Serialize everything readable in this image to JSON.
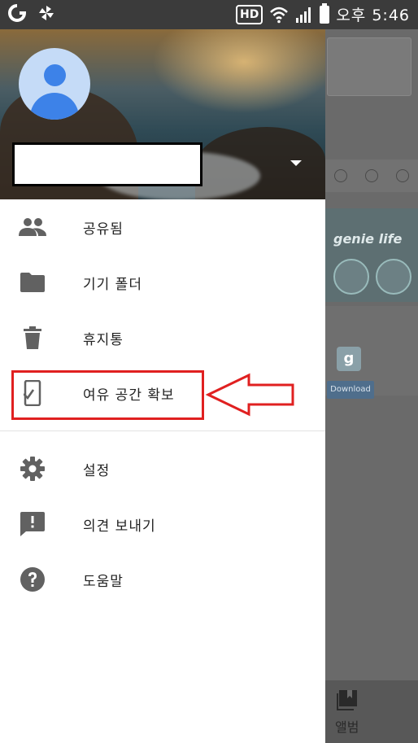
{
  "status_bar": {
    "hd": "HD",
    "time": "오후 5:46"
  },
  "drawer": {
    "menu": [
      {
        "id": "shared",
        "label": "공유됨",
        "icon": "people-icon"
      },
      {
        "id": "device-folders",
        "label": "기기 폴더",
        "icon": "folder-icon"
      },
      {
        "id": "trash",
        "label": "휴지통",
        "icon": "trash-icon"
      },
      {
        "id": "free-space",
        "label": "여유 공간 확보",
        "icon": "phone-check-icon"
      }
    ],
    "menu_secondary": [
      {
        "id": "settings",
        "label": "설정",
        "icon": "gear-icon"
      },
      {
        "id": "feedback",
        "label": "의견 보내기",
        "icon": "feedback-icon"
      },
      {
        "id": "help",
        "label": "도움말",
        "icon": "help-icon"
      }
    ]
  },
  "background_app": {
    "banner_title": "genie life",
    "download_button": "Download",
    "bottom_nav_label": "앨범"
  },
  "colors": {
    "highlight": "#e02020",
    "avatar_bg": "#c5dbf7",
    "avatar_fg": "#3d82e8",
    "icon_gray": "#616161"
  }
}
